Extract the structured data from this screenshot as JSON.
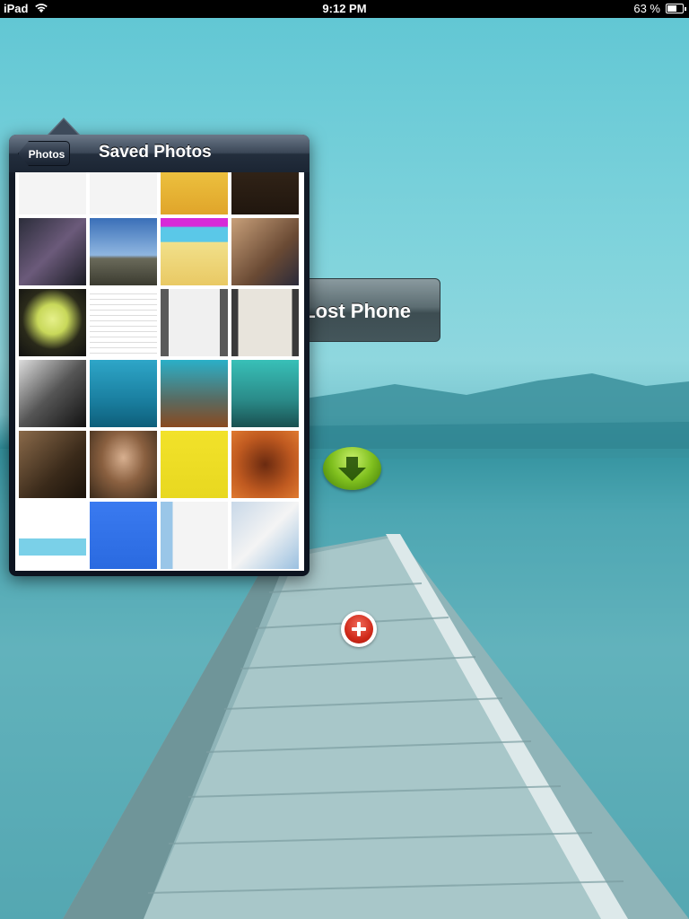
{
  "status_bar": {
    "carrier": "iPad",
    "time": "9:12 PM",
    "battery_percent": "63 %",
    "battery_level": 0.63,
    "wifi_icon": "wifi-icon",
    "battery_icon": "battery-icon"
  },
  "app": {
    "lost_phone_label": "Lost Phone",
    "download_icon": "down-arrow-icon",
    "add_icon": "plus-icon"
  },
  "popover": {
    "back_label": "Photos",
    "title": "Saved Photos",
    "photos": [
      {
        "kind": "sketch-white"
      },
      {
        "kind": "sketch-white"
      },
      {
        "kind": "cartoon-yellow"
      },
      {
        "kind": "dark-brown"
      },
      {
        "kind": "ipad-homescreen"
      },
      {
        "kind": "palm-sky"
      },
      {
        "kind": "cartoon-beach"
      },
      {
        "kind": "family-kids"
      },
      {
        "kind": "lime-glass"
      },
      {
        "kind": "document-white"
      },
      {
        "kind": "document-screen"
      },
      {
        "kind": "map-screen"
      },
      {
        "kind": "bw-people"
      },
      {
        "kind": "underwater-blue"
      },
      {
        "kind": "diver-1"
      },
      {
        "kind": "diver-2"
      },
      {
        "kind": "sepia-couple"
      },
      {
        "kind": "sepia-portrait"
      },
      {
        "kind": "cartoon-yellow-sketch"
      },
      {
        "kind": "orange-closeup"
      },
      {
        "kind": "teched-slide"
      },
      {
        "kind": "blue-web-form"
      },
      {
        "kind": "pdc-slide"
      },
      {
        "kind": "dialog-screen"
      },
      {
        "kind": "green-cartoon"
      },
      {
        "kind": "green-cartoon-2"
      },
      {
        "kind": "group-photo"
      },
      {
        "kind": "colorful-art"
      }
    ]
  }
}
